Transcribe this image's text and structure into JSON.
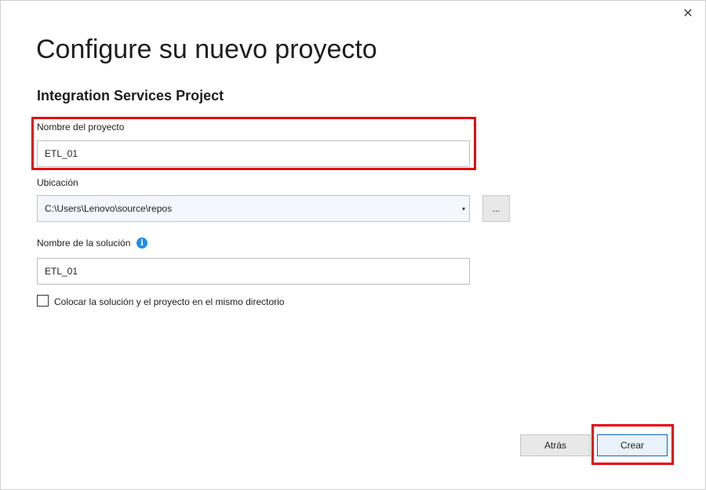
{
  "dialog": {
    "close_glyph": "✕",
    "title": "Configure su nuevo proyecto",
    "subtitle": "Integration Services Project"
  },
  "project_name": {
    "label": "Nombre del proyecto",
    "value": "ETL_01"
  },
  "location": {
    "label": "Ubicación",
    "value": "C:\\Users\\Lenovo\\source\\repos",
    "dropdown_glyph": "▾",
    "browse_label": "..."
  },
  "solution_name": {
    "label": "Nombre de la solución",
    "info_glyph": "i",
    "value": "ETL_01"
  },
  "same_directory": {
    "label": "Colocar la solución y el proyecto en el mismo directorio",
    "checked": false
  },
  "buttons": {
    "back": "Atrás",
    "create": "Crear"
  },
  "colors": {
    "highlight": "#e8000c",
    "info": "#1f8ce8",
    "primary_border": "#0a65c6"
  }
}
